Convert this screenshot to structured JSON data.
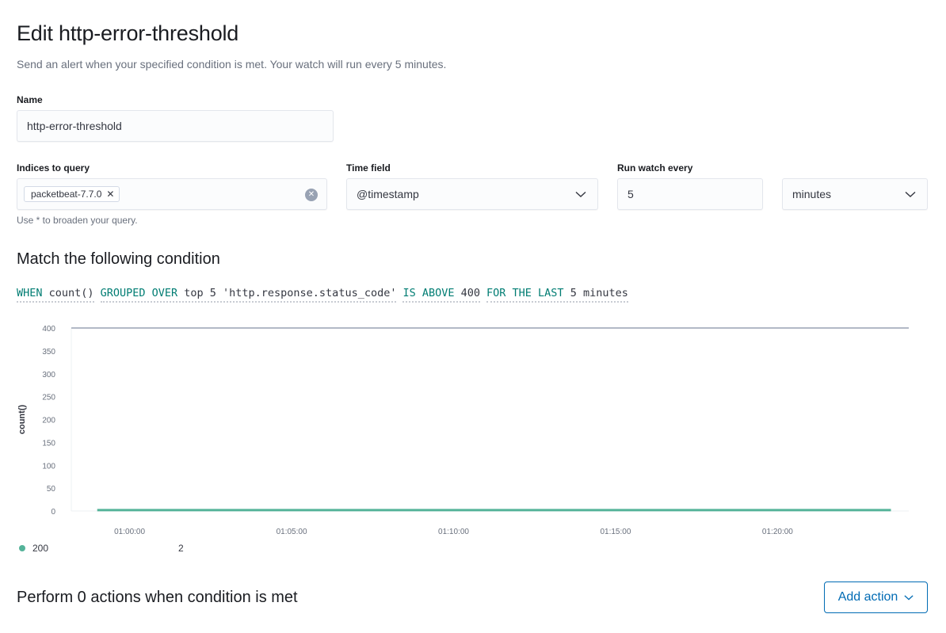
{
  "page": {
    "title": "Edit http-error-threshold",
    "subtitle": "Send an alert when your specified condition is met. Your watch will run every 5 minutes."
  },
  "form": {
    "name_label": "Name",
    "name_value": "http-error-threshold",
    "indices_label": "Indices to query",
    "indices_pill": "packetbeat-7.7.0",
    "indices_help": "Use * to broaden your query.",
    "time_field_label": "Time field",
    "time_field_value": "@timestamp",
    "run_every_label": "Run watch every",
    "run_every_value": "5",
    "run_every_unit": "minutes"
  },
  "condition": {
    "title": "Match the following condition",
    "when": "WHEN",
    "agg": "count()",
    "grouped_over": "GROUPED OVER",
    "group_value": "top 5 'http.response.status_code'",
    "is_above": "IS ABOVE",
    "threshold": "400",
    "for_the_last": "FOR THE LAST",
    "window": "5 minutes"
  },
  "chart_data": {
    "type": "line",
    "ylabel": "count()",
    "xlabel": "",
    "ylim": [
      0,
      400
    ],
    "yticks": [
      "0",
      "50",
      "100",
      "150",
      "200",
      "250",
      "300",
      "350",
      "400"
    ],
    "xticks": [
      "01:00:00",
      "01:05:00",
      "01:10:00",
      "01:15:00",
      "01:20:00"
    ],
    "threshold": 400,
    "series": [
      {
        "name": "200",
        "color": "#54b399",
        "x": [
          "00:59:00",
          "01:23:30"
        ],
        "values": [
          2,
          2
        ]
      }
    ],
    "legend_value": "2"
  },
  "actions": {
    "title": "Perform 0 actions when condition is met",
    "add_label": "Add action"
  },
  "colors": {
    "keyword": "#017d73",
    "primary": "#006bb4",
    "series": "#54b399"
  }
}
